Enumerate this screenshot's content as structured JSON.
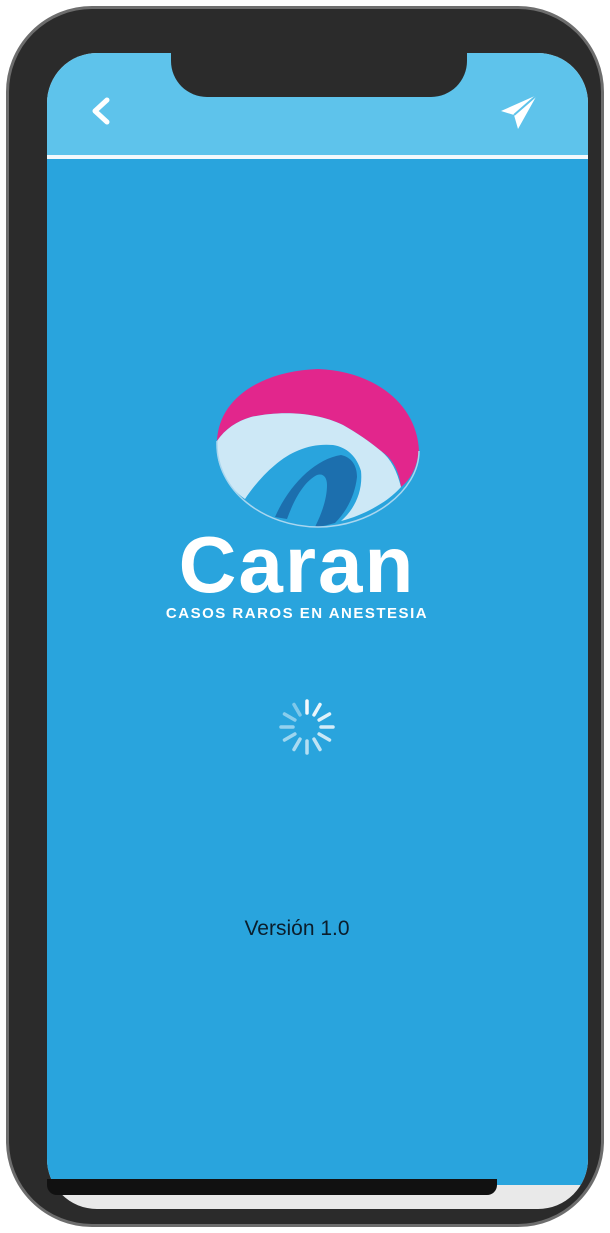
{
  "app": {
    "name": "Caran",
    "tagline": "CASOS RAROS EN ANESTESIA",
    "version_label": "Versión 1.0"
  },
  "header": {
    "back_icon": "chevron-left-icon",
    "send_icon": "paper-plane-icon"
  },
  "status": {
    "loading": "spinner-icon"
  },
  "colors": {
    "header": "#5ec3eb",
    "background": "#29a4dd",
    "logo_pink": "#e2268c",
    "logo_blue": "#1c6fae"
  }
}
